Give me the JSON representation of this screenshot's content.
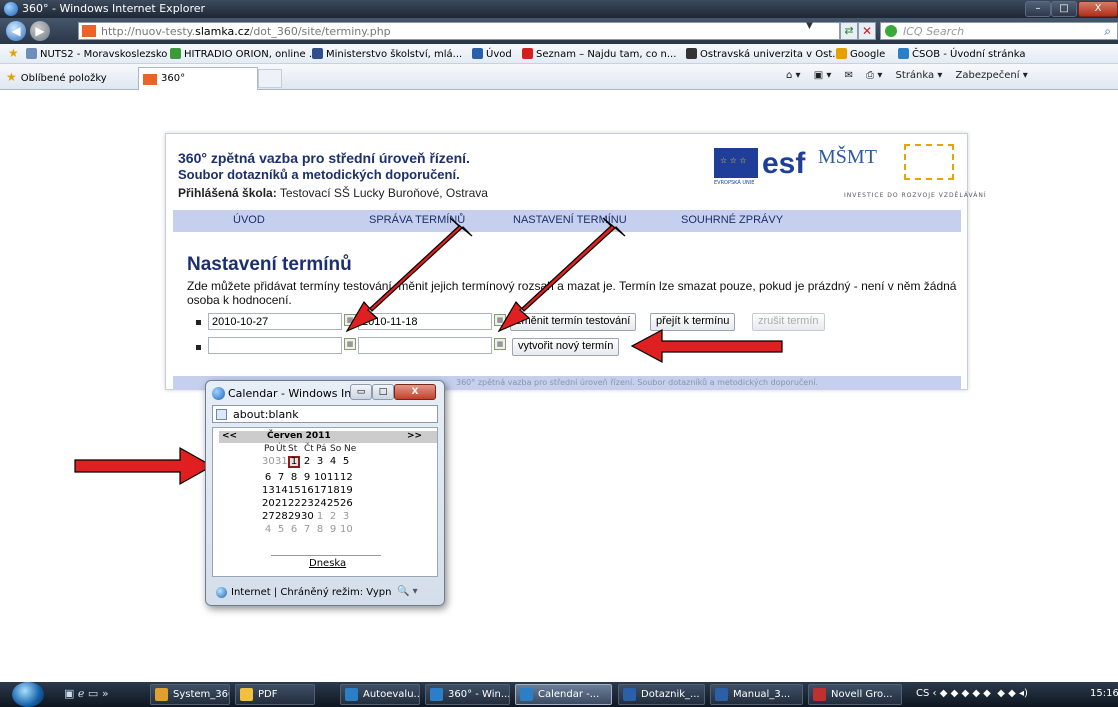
{
  "window": {
    "title": "360° - Windows Internet Explorer",
    "min": "–",
    "max": "□",
    "close": "X"
  },
  "address": {
    "url_prefix": "http://nuov-testy.",
    "url_domain": "slamka.cz",
    "url_suffix": "/dot_360/site/terminy.php",
    "search_placeholder": "ICQ Search"
  },
  "favorites": [
    {
      "label": "NUTS2 - Moravskoslezsko",
      "color": "#6e8db8"
    },
    {
      "label": "HITRADIO ORION, online ...",
      "color": "#3c9a3c"
    },
    {
      "label": "Ministerstvo školství, mlá...",
      "color": "#2f4f8a"
    },
    {
      "label": "Úvod",
      "color": "#2b5fa8"
    },
    {
      "label": "Seznam – Najdu tam, co n...",
      "color": "#d42020"
    },
    {
      "label": "Ostravská univerzita v Ost...",
      "color": "#333333"
    },
    {
      "label": "Google",
      "color": "#e6a100"
    },
    {
      "label": "ČSOB - Úvodní stránka",
      "color": "#2b7fc7"
    }
  ],
  "tabbar": {
    "favorites_label": "Oblíbené položky",
    "tab_label": "360°",
    "cmd_page": "Stránka ▾",
    "cmd_security": "Zabezpečení ▾"
  },
  "site": {
    "title": "360° zpětná vazba pro střední úroveň řízení.",
    "subtitle": "Soubor dotazníků a metodických doporučení.",
    "school_label": "Přihlášená škola:",
    "school_name": " Testovací SŠ Lucky Buroňové, Ostrava",
    "logos": {
      "eu": "EVROPSKÁ UNIE",
      "esf": "esf",
      "msmt": "MŠMT",
      "investice": "INVESTICE DO ROZVOJE VZDĚLÁVÁNÍ"
    },
    "nav": [
      "ÚVOD",
      "SPRÁVA TERMÍNŮ",
      "NASTAVENÍ TERMÍNU",
      "SOUHRNÉ ZPRÁVY"
    ],
    "heading": "Nastavení termínů",
    "description": "Zde můžete přidávat termíny testování, měnit jejich termínový rozsah a mazat je. Termín lze smazat pouze, pokud je prázdný - není v něm žádná osoba k hodnocení.",
    "row1": {
      "from": "2010-10-27",
      "to": "2010-11-18",
      "btn_change": "změnit termín testování",
      "btn_go": "přejít k termínu",
      "btn_cancel": "zrušit termín"
    },
    "row2": {
      "from": "",
      "to": "",
      "btn_create": "vytvořit nový termín"
    },
    "footer": "360° zpětná vazba pro střední úroveň řízení. Soubor dotazníků a metodických doporučení."
  },
  "calendar": {
    "window_title": "Calendar - Windows Int...",
    "address": "about:blank",
    "prev": "<<",
    "next": ">>",
    "month": "Červen 2011",
    "dow": [
      "Po",
      "Út",
      "St",
      "Čt",
      "Pá",
      "So",
      "Ne"
    ],
    "weeks": [
      [
        "30",
        "31",
        "1",
        "2",
        "3",
        "4",
        "5"
      ],
      [
        "6",
        "7",
        "8",
        "9",
        "10",
        "11",
        "12"
      ],
      [
        "13",
        "14",
        "15",
        "16",
        "17",
        "18",
        "19"
      ],
      [
        "20",
        "21",
        "22",
        "23",
        "24",
        "25",
        "26"
      ],
      [
        "27",
        "28",
        "29",
        "30",
        "1",
        "2",
        "3"
      ],
      [
        "4",
        "5",
        "6",
        "7",
        "8",
        "9",
        "10"
      ]
    ],
    "today_link": "Dneska",
    "status": "Internet | Chráněný režim: Vypn",
    "zoom": "🔍 ▾"
  },
  "taskbar": {
    "items": [
      {
        "label": "System_360",
        "color": "#e0a030"
      },
      {
        "label": "PDF",
        "color": "#f0c040"
      },
      {
        "label": "Autoevalu...",
        "color": "#2b7fc7"
      },
      {
        "label": "360° - Win...",
        "color": "#2b7fc7"
      },
      {
        "label": "Calendar -...",
        "color": "#2b7fc7"
      },
      {
        "label": "Dotaznik_...",
        "color": "#2b5fa8"
      },
      {
        "label": "Manual_3...",
        "color": "#2b5fa8"
      },
      {
        "label": "Novell Gro...",
        "color": "#c03030"
      }
    ],
    "lang": "CS",
    "clock": "15:16"
  }
}
